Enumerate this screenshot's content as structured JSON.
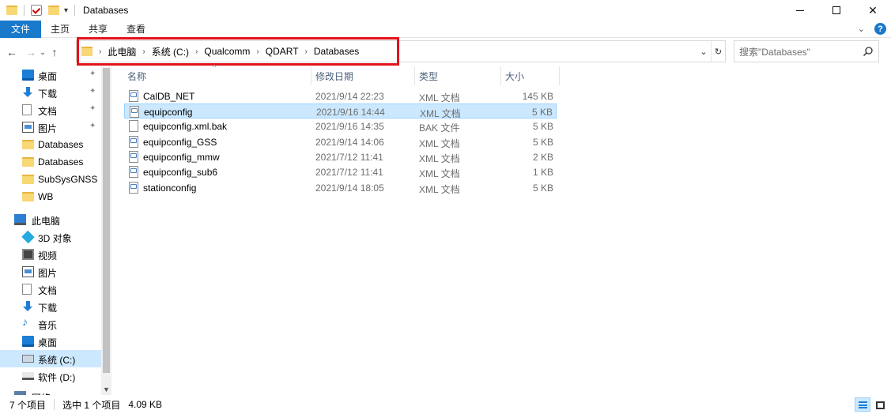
{
  "window": {
    "title": "Databases",
    "minimize_icon": "minimize-icon",
    "maximize_icon": "maximize-icon",
    "close_glyph": "✕"
  },
  "ribbon": {
    "tabs": [
      {
        "label": "文件",
        "active": true
      },
      {
        "label": "主页"
      },
      {
        "label": "共享"
      },
      {
        "label": "查看"
      }
    ],
    "expand_glyph": "⌄",
    "help_glyph": "?"
  },
  "nav": {
    "back_glyph": "←",
    "forward_glyph": "→",
    "recent_glyph": "⌄",
    "up_glyph": "↑",
    "breadcrumb": [
      "此电脑",
      "系统 (C:)",
      "Qualcomm",
      "QDART",
      "Databases"
    ],
    "crumb_separator": "›",
    "dropdown_glyph": "⌄",
    "refresh_glyph": "↻",
    "search_placeholder": "搜索\"Databases\""
  },
  "sidebar": {
    "quick_access": [
      {
        "label": "桌面",
        "icon": "desktop-icon",
        "pinned": true
      },
      {
        "label": "下载",
        "icon": "download-icon",
        "pinned": true
      },
      {
        "label": "文档",
        "icon": "document-icon",
        "pinned": true
      },
      {
        "label": "图片",
        "icon": "picture-icon",
        "pinned": true
      },
      {
        "label": "Databases",
        "icon": "folder-icon"
      },
      {
        "label": "Databases",
        "icon": "folder-icon"
      },
      {
        "label": "SubSysGNSS",
        "icon": "folder-icon"
      },
      {
        "label": "WB",
        "icon": "folder-icon"
      }
    ],
    "this_pc": {
      "label": "此电脑",
      "icon": "computer-icon"
    },
    "pc_items": [
      {
        "label": "3D 对象",
        "icon": "3d-objects-icon"
      },
      {
        "label": "视频",
        "icon": "video-icon"
      },
      {
        "label": "图片",
        "icon": "picture-icon"
      },
      {
        "label": "文档",
        "icon": "document-icon"
      },
      {
        "label": "下载",
        "icon": "download-icon"
      },
      {
        "label": "音乐",
        "icon": "music-icon"
      },
      {
        "label": "桌面",
        "icon": "desktop-icon"
      },
      {
        "label": "系统 (C:)",
        "icon": "system-drive-icon",
        "selected": true
      },
      {
        "label": "软件 (D:)",
        "icon": "drive-icon"
      }
    ],
    "network": {
      "label": "网络",
      "icon": "network-icon"
    },
    "pin_glyph": "📌"
  },
  "columns": {
    "name": "名称",
    "date": "修改日期",
    "type": "类型",
    "size": "大小",
    "sort_glyph": "^"
  },
  "files": [
    {
      "name": "CalDB_NET",
      "date": "2021/9/14 22:23",
      "type": "XML 文档",
      "size": "145 KB",
      "kind": "xml"
    },
    {
      "name": "equipconfig",
      "date": "2021/9/16 14:44",
      "type": "XML 文档",
      "size": "5 KB",
      "kind": "xml",
      "selected": true
    },
    {
      "name": "equipconfig.xml.bak",
      "date": "2021/9/16 14:35",
      "type": "BAK 文件",
      "size": "5 KB",
      "kind": "bak"
    },
    {
      "name": "equipconfig_GSS",
      "date": "2021/9/14 14:06",
      "type": "XML 文档",
      "size": "5 KB",
      "kind": "xml"
    },
    {
      "name": "equipconfig_mmw",
      "date": "2021/7/12 11:41",
      "type": "XML 文档",
      "size": "2 KB",
      "kind": "xml"
    },
    {
      "name": "equipconfig_sub6",
      "date": "2021/7/12 11:41",
      "type": "XML 文档",
      "size": "1 KB",
      "kind": "xml"
    },
    {
      "name": "stationconfig",
      "date": "2021/9/14 18:05",
      "type": "XML 文档",
      "size": "5 KB",
      "kind": "xml"
    }
  ],
  "status": {
    "item_count": "7 个项目",
    "selection": "选中 1 个项目",
    "selection_size": "4.09 KB"
  },
  "colors": {
    "accent": "#1979ca",
    "selection_bg": "#cce8ff",
    "highlight_border": "#e4121b"
  }
}
